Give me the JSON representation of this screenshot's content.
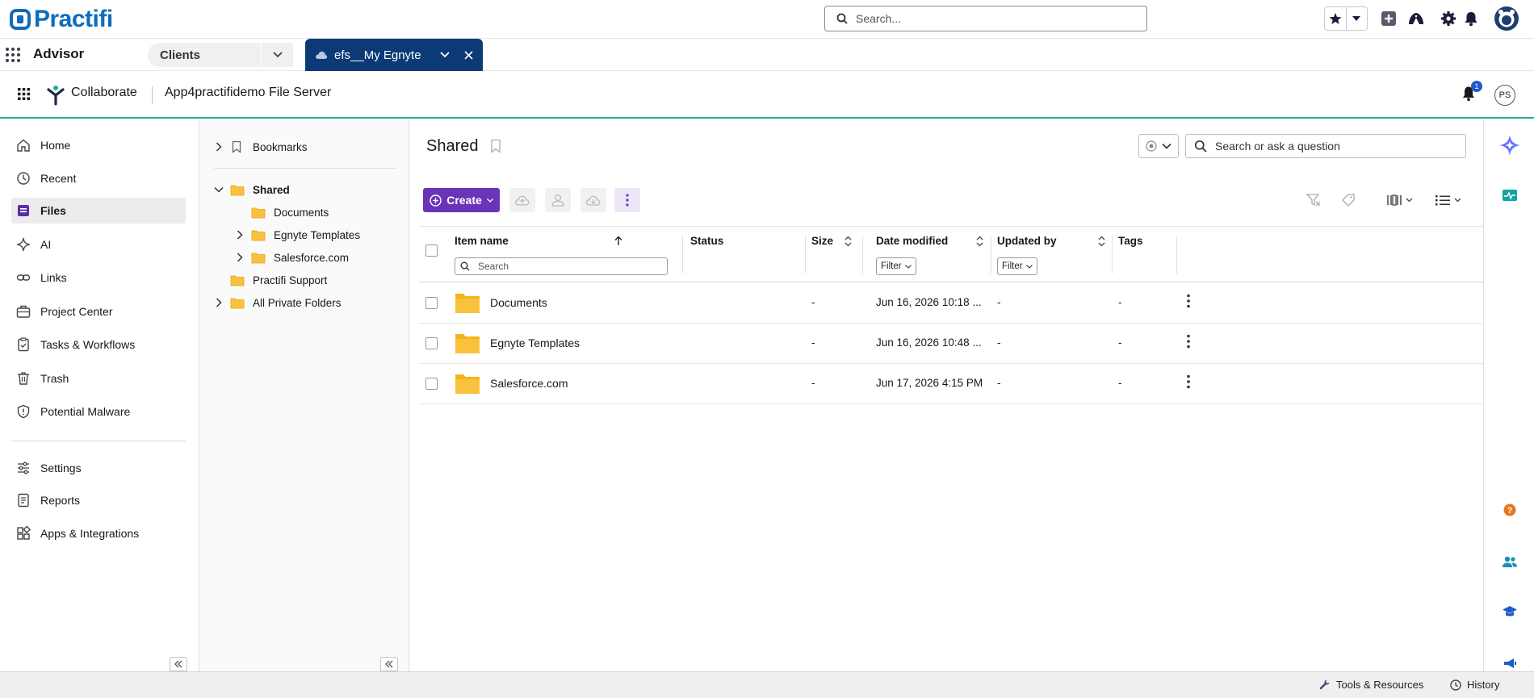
{
  "brand": {
    "name": "Practifi"
  },
  "global_search": {
    "placeholder": "Search..."
  },
  "app_bar": {
    "app_name": "Advisor",
    "clients_tab": "Clients",
    "active_tab": "efs__My Egnyte"
  },
  "egnyte": {
    "app_label": "Collaborate",
    "server_name": "App4practifidemo File Server",
    "notification_count": "1",
    "user_initials": "PS"
  },
  "left_nav": {
    "items": [
      {
        "label": "Home",
        "icon": "home-icon"
      },
      {
        "label": "Recent",
        "icon": "clock-icon"
      },
      {
        "label": "Files",
        "icon": "files-icon",
        "active": true
      },
      {
        "label": "AI",
        "icon": "sparkle-icon"
      },
      {
        "label": "Links",
        "icon": "link-icon"
      },
      {
        "label": "Project Center",
        "icon": "briefcase-icon"
      },
      {
        "label": "Tasks & Workflows",
        "icon": "clipboard-icon"
      },
      {
        "label": "Trash",
        "icon": "trash-icon"
      },
      {
        "label": "Potential Malware",
        "icon": "shield-icon"
      }
    ],
    "bottom_items": [
      {
        "label": "Settings",
        "icon": "sliders-icon"
      },
      {
        "label": "Reports",
        "icon": "report-icon"
      },
      {
        "label": "Apps & Integrations",
        "icon": "apps-icon"
      }
    ]
  },
  "tree": {
    "bookmarks": "Bookmarks",
    "shared": "Shared",
    "children": [
      "Documents",
      "Egnyte Templates",
      "Salesforce.com"
    ],
    "practifi_support": "Practifi Support",
    "all_private": "All Private Folders"
  },
  "main": {
    "title": "Shared",
    "ai_search_placeholder": "Search or ask a question",
    "create_label": "Create",
    "columns": {
      "item_name": "Item name",
      "status": "Status",
      "size": "Size",
      "date_modified": "Date modified",
      "updated_by": "Updated by",
      "tags": "Tags"
    },
    "name_search_placeholder": "Search",
    "filter_label": "Filter",
    "rows": [
      {
        "name": "Documents",
        "size": "-",
        "date": "Jun 16, 2026 10:18 ...",
        "updated_by": "-",
        "tags": "-"
      },
      {
        "name": "Egnyte Templates",
        "size": "-",
        "date": "Jun 16, 2026 10:48 ...",
        "updated_by": "-",
        "tags": "-"
      },
      {
        "name": "Salesforce.com",
        "size": "-",
        "date": "Jun 17, 2026 4:15 PM",
        "updated_by": "-",
        "tags": "-"
      }
    ]
  },
  "footer": {
    "tools": "Tools & Resources",
    "history": "History"
  },
  "colors": {
    "brand_blue": "#0f6cbd",
    "active_tab_navy": "#0b3a76",
    "create_purple": "#6a34b8",
    "folder_yellow": "#f9c23c",
    "egnyte_teal": "#2aa7a0"
  }
}
